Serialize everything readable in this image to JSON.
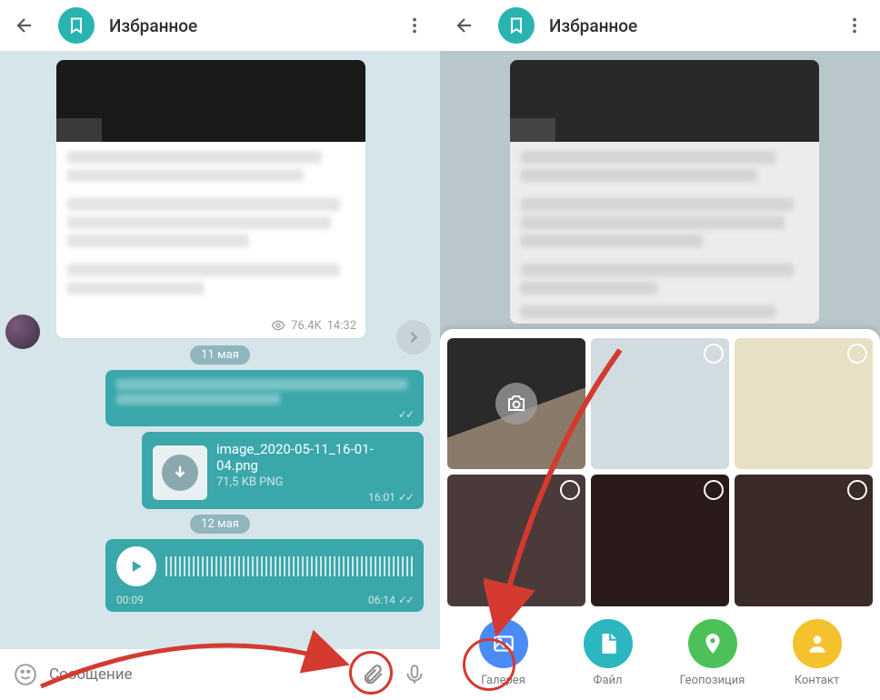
{
  "left": {
    "header": {
      "title": "Избранное"
    },
    "post": {
      "views": "76.4K",
      "time": "14:32"
    },
    "date1": "11 мая",
    "date2": "12 мая",
    "file": {
      "name": "image_2020-05-11_16-01-04.png",
      "size": "71,5 KB PNG",
      "time": "16:01"
    },
    "voice": {
      "elapsed": "00:09",
      "total": "06:14"
    },
    "input": {
      "placeholder": "Сообщение"
    }
  },
  "right": {
    "header": {
      "title": "Избранное"
    },
    "actions": {
      "gallery": "Галерея",
      "file": "Файл",
      "location": "Геопозиция",
      "contact": "Контакт"
    }
  }
}
